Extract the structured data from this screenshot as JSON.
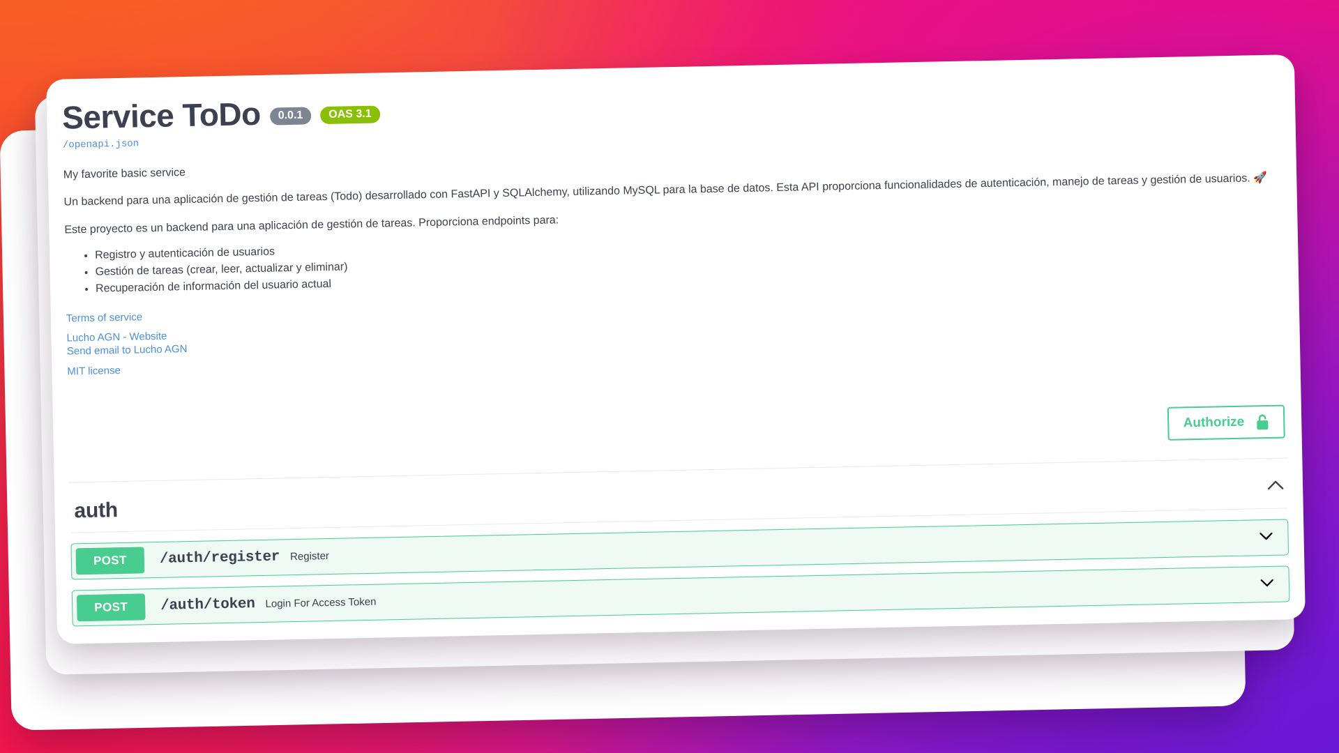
{
  "colors": {
    "accent_green": "#49cc90",
    "link_blue": "#4a90e2",
    "badge_version_bg": "#7d8492",
    "badge_oas_bg": "#89bf04",
    "text": "#3b4151",
    "bg_gradient_orange": "#f8681f",
    "bg_gradient_pink": "#ea0d86",
    "bg_gradient_crimson": "#f9164f",
    "bg_gradient_purple": "#6d18d6"
  },
  "info": {
    "title": "Service ToDo",
    "version_badge": "0.0.1",
    "oas_badge": "OAS 3.1",
    "spec_link": "/openapi.json",
    "summary": "My favorite basic service",
    "description_paragraph": "Un backend para una aplicación de gestión de tareas (Todo) desarrollado con FastAPI y SQLAlchemy, utilizando MySQL para la base de datos. Esta API proporciona funcionalidades de autenticación, manejo de tareas y gestión de usuarios. 🚀",
    "description_intro": "Este proyecto es un backend para una aplicación de gestión de tareas. Proporciona endpoints para:",
    "features": [
      "Registro y autenticación de usuarios",
      "Gestión de tareas (crear, leer, actualizar y eliminar)",
      "Recuperación de información del usuario actual"
    ],
    "terms_of_service_label": "Terms of service",
    "contact_label": "Lucho AGN - Website",
    "email_label": "Send email to Lucho AGN",
    "license_label": "MIT license"
  },
  "toolbar": {
    "authorize_label": "Authorize",
    "authorize_icon": "unlock-icon"
  },
  "tags": [
    {
      "name": "auth",
      "expanded": true,
      "toggle_icon": "chevron-up-icon",
      "operations": [
        {
          "method": "POST",
          "path": "/auth/register",
          "summary": "Register",
          "expanded": false,
          "toggle_icon": "chevron-down-icon"
        },
        {
          "method": "POST",
          "path": "/auth/token",
          "summary": "Login For Access Token",
          "expanded": false,
          "toggle_icon": "chevron-down-icon"
        }
      ]
    }
  ]
}
